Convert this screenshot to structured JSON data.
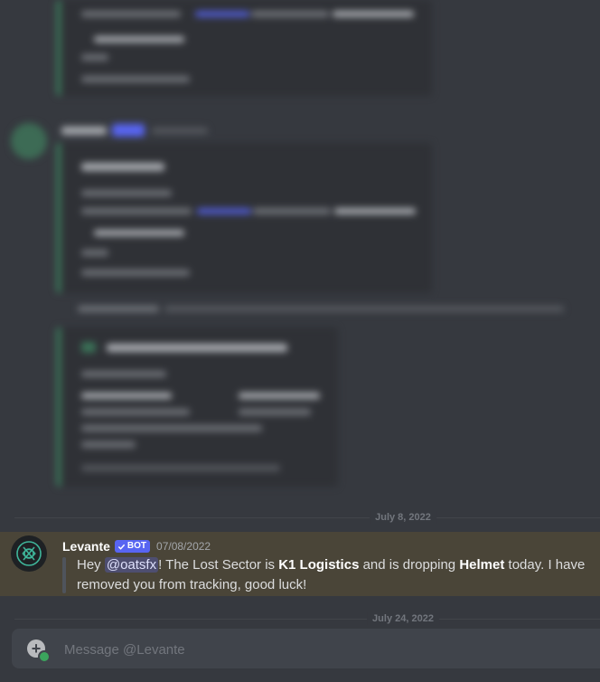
{
  "dividers": {
    "first_date": "July 8, 2022",
    "second_date": "July 24, 2022"
  },
  "message": {
    "username": "Levante",
    "bot_tag": "BOT",
    "timestamp": "07/08/2022",
    "text_hey": "Hey ",
    "mention": "@oatsfx",
    "text_lost_sector": "! The Lost Sector is ",
    "lost_sector": "K1 Logistics",
    "text_dropping": " and is dropping ",
    "drop": "Helmet",
    "text_tail": " today. I have removed you from tracking, good luck!"
  },
  "composer": {
    "placeholder": "Message @Levante"
  },
  "icons": {
    "avatar": "levante-logo-icon",
    "attach": "plus-circle-icon",
    "badge_check": "checkmark-icon"
  },
  "colors": {
    "background": "#36393f",
    "highlight": "#4a4538",
    "blurple": "#5865f2",
    "input": "#40444b"
  }
}
